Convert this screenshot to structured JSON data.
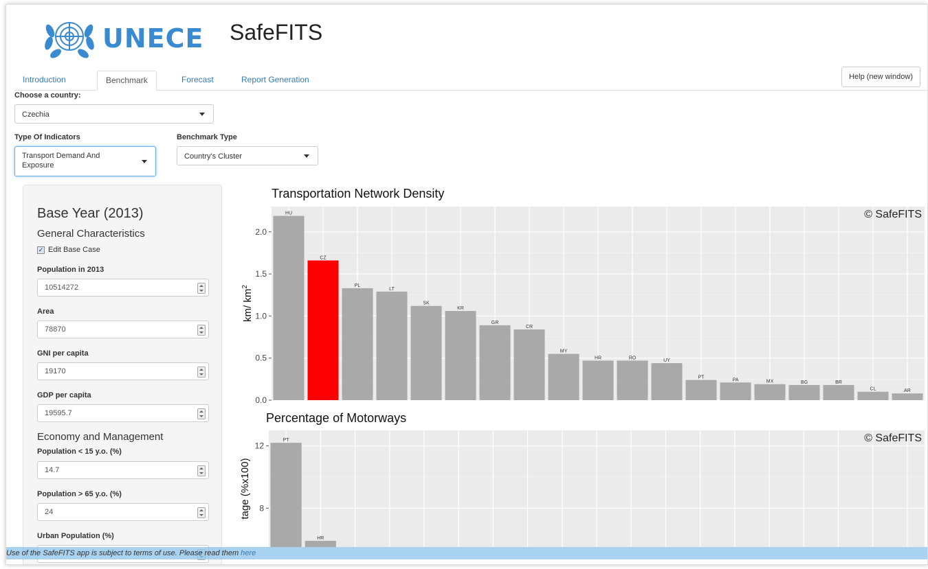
{
  "brand": {
    "logo_text": "UNECE",
    "app_title": "SafeFITS"
  },
  "tabs": [
    {
      "label": "Introduction",
      "active": false
    },
    {
      "label": "Benchmark",
      "active": true
    },
    {
      "label": "Forecast",
      "active": false
    },
    {
      "label": "Report Generation",
      "active": false
    }
  ],
  "help_button": "Help (new window)",
  "controls": {
    "country_label": "Choose a country:",
    "country_value": "Czechia",
    "indicator_type_label": "Type Of Indicators",
    "indicator_type_value_line1": "Transport Demand And",
    "indicator_type_value_line2": "Exposure",
    "benchmark_type_label": "Benchmark Type",
    "benchmark_type_value": "Country's Cluster"
  },
  "sidebar": {
    "title": "Base Year (2013)",
    "section1": "General Characteristics",
    "edit_base_case": "Edit Base Case",
    "edit_base_case_checked": true,
    "fields": [
      {
        "label": "Population in 2013",
        "value": "10514272"
      },
      {
        "label": "Area",
        "value": "78870"
      },
      {
        "label": "GNI per capita",
        "value": "19170"
      },
      {
        "label": "GDP per capita",
        "value": "19595.7"
      }
    ],
    "section2": "Economy and Management",
    "fields2": [
      {
        "label": "Population < 15 y.o. (%)",
        "value": "14.7"
      },
      {
        "label": "Population > 65 y.o. (%)",
        "value": "24"
      }
    ],
    "urban_label": "Urban Population (%)"
  },
  "footer": {
    "text": "Use of the SafeFITS app is subject to terms of use. Please read them ",
    "link": "here"
  },
  "colors": {
    "highlight": "#ff0000",
    "bar": "#a9a9a9",
    "panel": "#ebebeb",
    "accent": "#3a8ad1"
  },
  "chart_data": [
    {
      "type": "bar",
      "title": "Transportation Network Density",
      "watermark": "© SafeFITS",
      "ylabel": "km/ km",
      "ylabel_sup": "2",
      "ylim": [
        0,
        2.3
      ],
      "yticks": [
        0.0,
        0.5,
        1.0,
        1.5,
        2.0
      ],
      "ytick_labels": [
        "0.0",
        "0.5",
        "1.0",
        "1.5",
        "2.0"
      ],
      "highlight": "CZ",
      "categories": [
        "HU",
        "CZ",
        "PL",
        "LT",
        "SK",
        "KR",
        "GR",
        "CR",
        "MY",
        "HR",
        "RO",
        "UY",
        "PT",
        "PA",
        "MX",
        "BG",
        "BR",
        "CL",
        "AR"
      ],
      "values": [
        2.19,
        1.66,
        1.33,
        1.29,
        1.12,
        1.06,
        0.89,
        0.84,
        0.55,
        0.47,
        0.47,
        0.44,
        0.24,
        0.21,
        0.19,
        0.18,
        0.18,
        0.1,
        0.08
      ]
    },
    {
      "type": "bar",
      "title": "Percentage of Motorways",
      "watermark": "© SafeFITS",
      "ylabel": "tage (%x100)",
      "ylim": [
        5.5,
        13
      ],
      "yticks": [
        8,
        12
      ],
      "ytick_labels": [
        "8",
        "12"
      ],
      "categories": [
        "PT",
        "HR"
      ],
      "values": [
        12.2,
        5.9
      ]
    }
  ]
}
